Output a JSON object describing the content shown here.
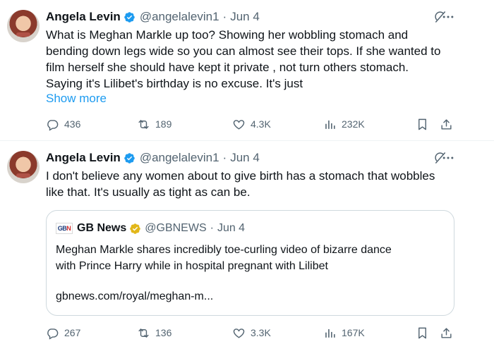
{
  "tweets": [
    {
      "author_name": "Angela Levin",
      "handle": "@angelalevin1",
      "separator": "·",
      "date": "Jun 4",
      "text_lines": [
        "What is Meghan Markle up too?  Showing her wobbling stomach and",
        "bending down legs wide so you can almost see their tops.    If she wanted to",
        "film herself she should have kept it private , not  turn others  stomach.",
        "Saying it's Lilibet's birthday is no excuse. It's just"
      ],
      "show_more": "Show more",
      "replies": "436",
      "reposts": "189",
      "likes": "4.3K",
      "views": "232K"
    },
    {
      "author_name": "Angela Levin",
      "handle": "@angelalevin1",
      "separator": "·",
      "date": "Jun 4",
      "text_lines": [
        "I don't believe any women about to give birth has a stomach that wobbles",
        "like that.  It's usually as tight as can be."
      ],
      "quote": {
        "logo_text_a": "GB",
        "logo_text_b": "N",
        "author_name": "GB News",
        "handle": "@GBNEWS",
        "separator": "·",
        "date": "Jun 4",
        "text_lines": [
          "Meghan Markle shares incredibly toe-curling video of bizarre dance",
          "with Prince Harry while in hospital pregnant with Lilibet"
        ],
        "link": "gbnews.com/royal/meghan-m..."
      },
      "replies": "267",
      "reposts": "136",
      "likes": "3.3K",
      "views": "167K"
    }
  ],
  "icons": {
    "verified": "verified-badge-icon",
    "gold_verified": "gold-verified-badge-icon",
    "grok": "grok-icon",
    "more": "more-icon",
    "reply": "reply-icon",
    "repost": "repost-icon",
    "like": "like-icon",
    "views": "views-icon",
    "bookmark": "bookmark-icon",
    "share": "share-icon"
  },
  "colors": {
    "accent": "#1d9bf0",
    "muted": "#536471",
    "gold": "#e2b719"
  }
}
